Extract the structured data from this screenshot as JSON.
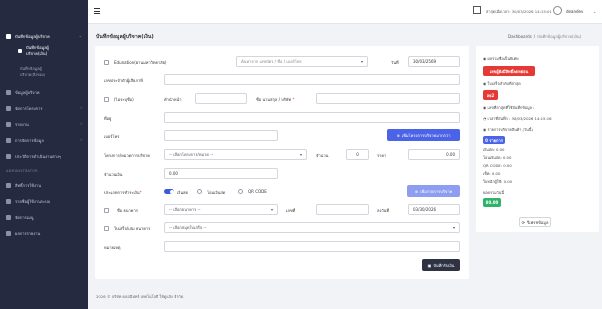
{
  "sidebar": {
    "menu": [
      {
        "label": "บันทึกข้อมูลผู้บริจาค",
        "caret": "⌄"
      },
      {
        "label": "บันทึกข้อมูลผู้บริจาค(เงิน)"
      },
      {
        "label": "บันทึกข้อมูลผู้บริจาค(สิ่งของ)"
      },
      {
        "label": "ข้อมูลผู้บริจาค"
      },
      {
        "label": "จัดการโครงการ",
        "caret": "›"
      },
      {
        "label": "รายงาน",
        "caret": "›"
      },
      {
        "label": "การจัดการข้อมูล",
        "caret": "›"
      },
      {
        "label": "ประวัติการดำเนินงานต่างๆ"
      }
    ],
    "admin_header": "ADMINISTRATOR",
    "admin": [
      {
        "label": "สิทธิ์การใช้งาน"
      },
      {
        "label": "รายชื่อผู้ใช้งานระบบ"
      },
      {
        "label": "จัดการเมนู"
      },
      {
        "label": "ผลการรายงาน"
      }
    ]
  },
  "topbar": {
    "datetime": "ล่าสุดเมื่อเวลา: 30/03/2026 14:15:01",
    "username": "deandev"
  },
  "page": {
    "title": "บันทึกข้อมูลผู้บริจาค(เงิน)",
    "breadcrumb": [
      "Dashboards",
      "บันทึกข้อมูลผู้บริจาค(เงิน)"
    ]
  },
  "form": {
    "edu_label": "Edunation(ผ่านมหาวิทยาลัย)",
    "search_placeholder": "ค้นหาจาก เลขบัตร / ชื่อ / เบอร์โทร",
    "date_label": "วันที่",
    "date_value": "30/03/2569",
    "tax_id_label": "เลขประจำตัวผู้เสียภาษี",
    "anon_label": "(ไม่ระบุชื่อ)",
    "title_label": "คำนำหน้า",
    "name_label": "ชื่อ นามสกุล / บริษัท",
    "address_label": "ที่อยู่",
    "phone_label": "เบอร์โทร",
    "add_project_btn": "เพิ่มโครงการบริจาคมากกว่า",
    "project_label": "โครงการ/หมวดการบริจาค",
    "project_select": "-- เลือกโครงการ/หมวด --",
    "qty_label": "จำนวน",
    "qty_value": "0",
    "price_label": "ราคา",
    "price_value": "0.00",
    "amount_label": "จำนวนเงิน",
    "amount_value": "0.00",
    "pay_method_label": "ประเภทการชำระเงิน",
    "pay_cash": "เงินสด",
    "pay_transfer": "โอนเงินสด",
    "pay_qr": "QR CODE",
    "add_list_btn": "เพิ่มรายการบริจาค",
    "bank_label": "ชื่อ ธนาคาร",
    "bank_select": "-- เลือกธนาคาร --",
    "account_no_label": "เลขที่",
    "transfer_date_label": "ลงวันที่",
    "transfer_date_value": "03/30/2026",
    "receipt_book_label": "ใบเสร็จ/เล่ม ธนาคาร",
    "receipt_book_select": "-- เลือกสมุดใบเสร็จ --",
    "note_label": "หมายเหตุ",
    "save_btn": "บันทึกรับเงิน"
  },
  "summary": {
    "donor_type_label": "ผลรวมชื่อเป็นพิเศษ",
    "donor_badge": "เลขผู้ยังมีสิทธิ์ลดหย่อน",
    "receipt_count_label": "ใบเสร็จลำดับที่ล่าสุด",
    "receipt_badge": "ลย2",
    "last_receipt_label": "เลขที่ล่าสุดที่ใช้บันทึกข้อมูล :",
    "last_time": "เวลาที่บันทึก : 30/03/2026 14:15:16",
    "type_label": "รายการบริจาคสินค้า (วันนี้)",
    "list_badge": "0 รายการ",
    "cash": "เงินสด: 0.00",
    "transfer": "โอนเงินสด: 0.00",
    "qr": "QR CODE: 0.00",
    "cheque": "เช็ค: 0.00",
    "other": "ใบหน้าผู้ใช้: 0.00",
    "total_label": "ยอดรวมวันนี้",
    "total_badge": "80.00",
    "refresh_btn": "รีเฟรชข้อมูล"
  },
  "footer": "2026 © บริษัท ดลอนีฟทร์ เทคโนโลยี ให้ดูแลิง จำกัด.",
  "colors": {
    "primary": "#4a63e7",
    "danger": "#e53935",
    "success": "#2fb36b",
    "sidebar": "#252a40"
  }
}
